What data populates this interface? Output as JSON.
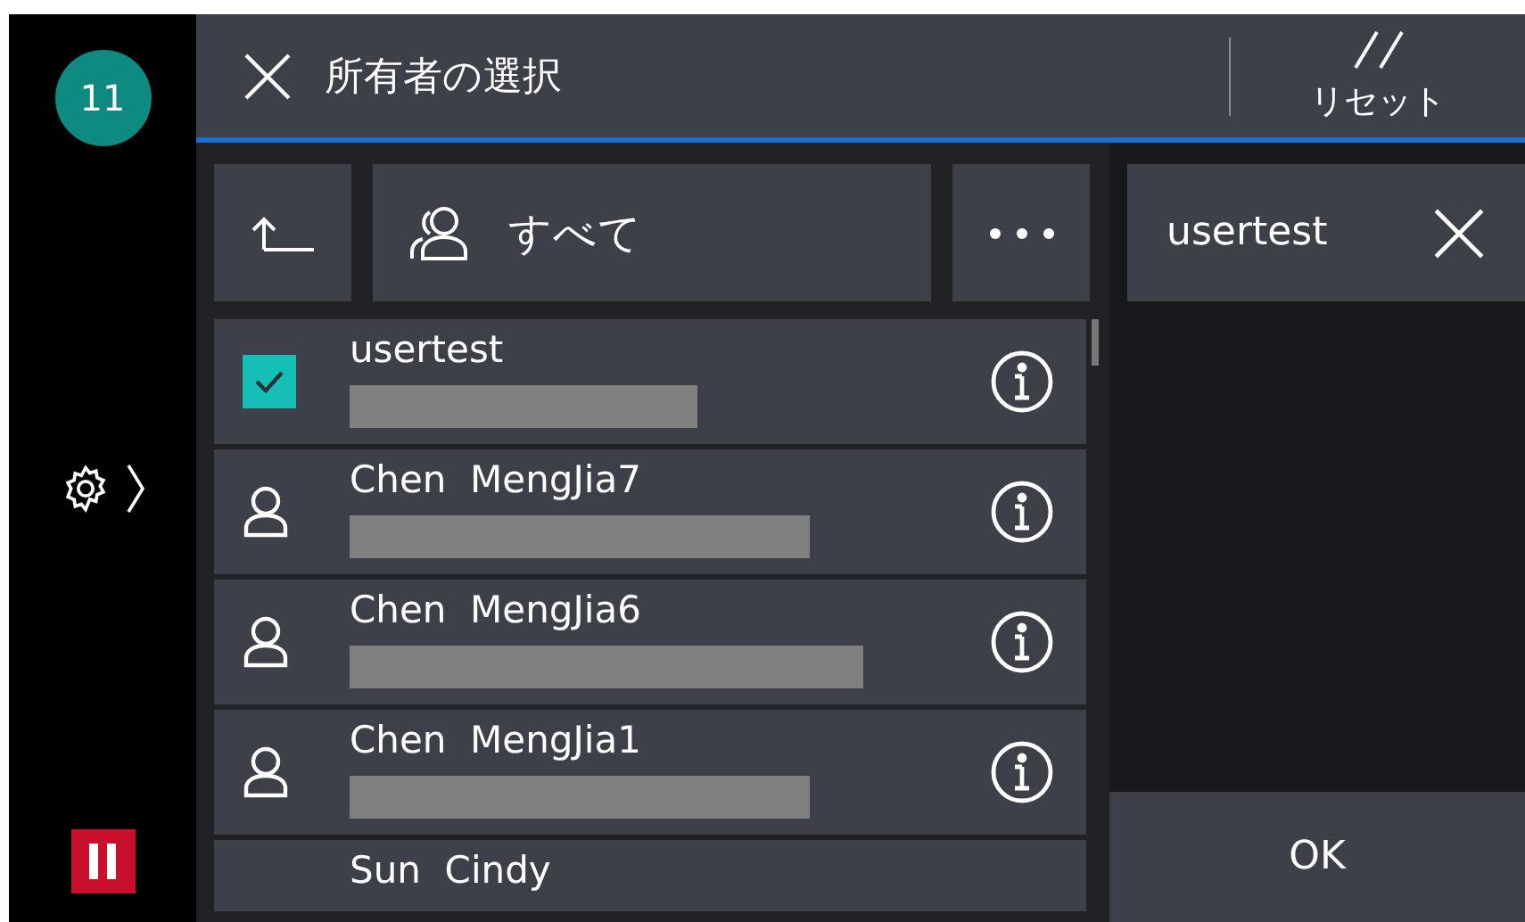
{
  "sidebar": {
    "badge": "11"
  },
  "header": {
    "title": "所有者の選択",
    "reset_label": "リセット"
  },
  "toolbar": {
    "filter_label": "すべて"
  },
  "users": [
    {
      "name": "usertest",
      "checked": true
    },
    {
      "name": "Chen  MengJia7",
      "checked": false
    },
    {
      "name": "Chen  MengJia6",
      "checked": false
    },
    {
      "name": "Chen  MengJia1",
      "checked": false
    },
    {
      "name": "Sun  Cindy",
      "checked": false
    }
  ],
  "selected_chips": [
    {
      "label": "usertest"
    }
  ],
  "ok_label": "OK"
}
